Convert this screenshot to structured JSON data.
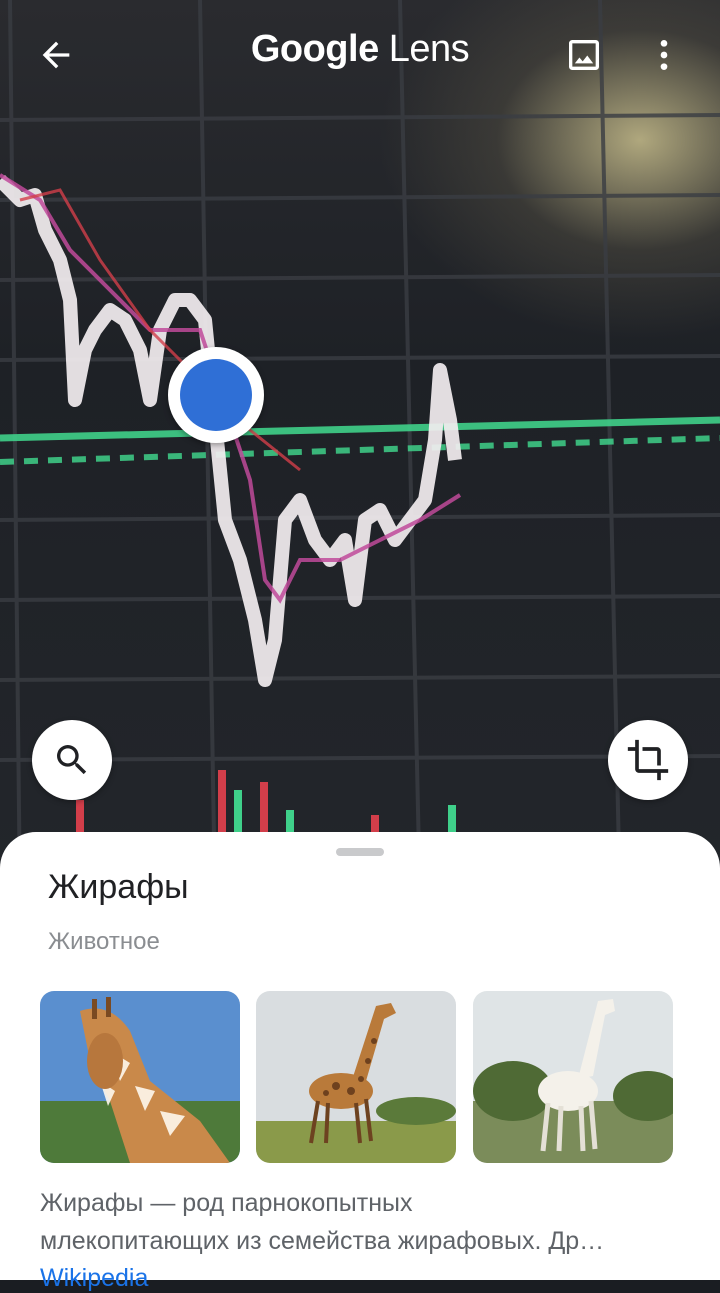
{
  "app": {
    "title_brand": "Google",
    "title_product": "Lens"
  },
  "icons": {
    "back": "arrow-back-icon",
    "gallery": "image-icon",
    "more": "more-vert-icon",
    "search": "search-icon",
    "crop": "crop-icon"
  },
  "colors": {
    "accent_dot": "#2f6fd6",
    "link": "#1a73e8",
    "chart_line": "#3fd08a"
  },
  "result": {
    "title": "Жирафы",
    "subtitle": "Животное",
    "description_line1": "Жирафы — род парнокопытных",
    "description_line2": "млекопитающих из семейства жирафовых. Др…",
    "source": "Wikipedia"
  },
  "thumbnails": [
    {
      "name": "giraffe-closeup"
    },
    {
      "name": "giraffe-standing"
    },
    {
      "name": "white-giraffe"
    }
  ]
}
